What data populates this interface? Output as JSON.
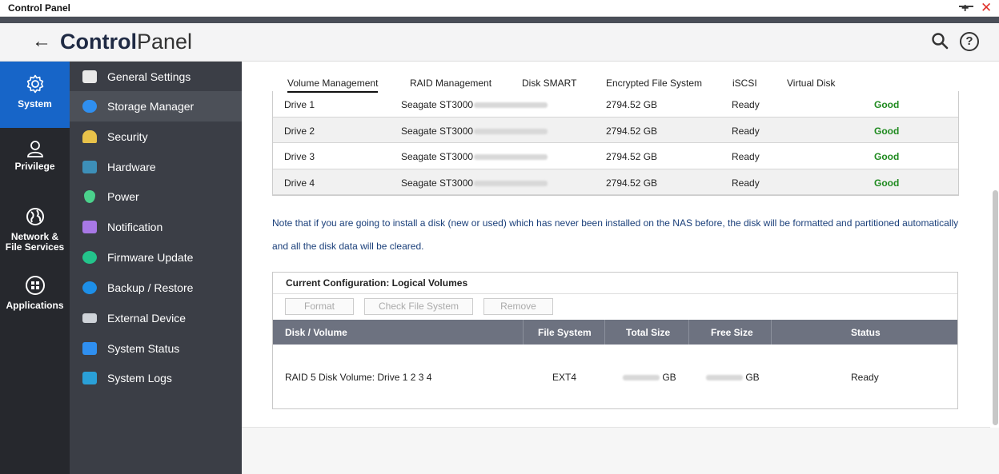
{
  "window": {
    "title": "Control Panel",
    "controls": {
      "minimize": "—",
      "maximize": "+",
      "close": "✕"
    }
  },
  "header": {
    "title_bold": "Control",
    "title_thin": "Panel",
    "back_icon": "←",
    "help_icon": "?"
  },
  "rail": {
    "items": [
      {
        "label": "System",
        "icon": "gear-icon"
      },
      {
        "label": "Privilege",
        "icon": "user-icon"
      },
      {
        "label_line1": "Network &",
        "label_line2": "File Services",
        "icon": "globe-icon"
      },
      {
        "label": "Applications",
        "icon": "apps-grid-icon"
      }
    ]
  },
  "submenu": {
    "items": [
      {
        "label": "General Settings",
        "icon_color": "#e8e8e8"
      },
      {
        "label": "Storage Manager",
        "icon_color": "#2f8ff0"
      },
      {
        "label": "Security",
        "icon_color": "#e8c24a"
      },
      {
        "label": "Hardware",
        "icon_color": "#3d8fb8"
      },
      {
        "label": "Power",
        "icon_color": "#4bd18c"
      },
      {
        "label": "Notification",
        "icon_color": "#a878e6"
      },
      {
        "label": "Firmware Update",
        "icon_color": "#23c48b"
      },
      {
        "label": "Backup / Restore",
        "icon_color": "#1d8fe8"
      },
      {
        "label": "External Device",
        "icon_color": "#cfd3d9"
      },
      {
        "label": "System Status",
        "icon_color": "#2f8ff0"
      },
      {
        "label": "System Logs",
        "icon_color": "#2aa0d8"
      }
    ]
  },
  "tabs": [
    "Volume Management",
    "RAID Management",
    "Disk SMART",
    "Encrypted File System",
    "iSCSI",
    "Virtual Disk"
  ],
  "drives": [
    {
      "name": "Drive 1",
      "model": "Seagate ST3000",
      "size": "2794.52 GB",
      "status": "Ready",
      "health": "Good"
    },
    {
      "name": "Drive 2",
      "model": "Seagate ST3000",
      "size": "2794.52 GB",
      "status": "Ready",
      "health": "Good"
    },
    {
      "name": "Drive 3",
      "model": "Seagate ST3000",
      "size": "2794.52 GB",
      "status": "Ready",
      "health": "Good"
    },
    {
      "name": "Drive 4",
      "model": "Seagate ST3000",
      "size": "2794.52 GB",
      "status": "Ready",
      "health": "Good"
    }
  ],
  "note": "Note that if you are going to install a disk (new or used) which has never been installed on the NAS before, the disk will be formatted and partitioned automatically and all the disk data will be cleared.",
  "logical": {
    "heading": "Current Configuration: Logical Volumes",
    "buttons": {
      "format": "Format",
      "check": "Check File System",
      "remove": "Remove"
    },
    "columns": {
      "disk": "Disk / Volume",
      "fs": "File System",
      "total": "Total Size",
      "free": "Free Size",
      "status": "Status"
    },
    "row": {
      "disk": "RAID 5 Disk Volume: Drive 1 2 3 4",
      "fs": "EXT4",
      "total_unit": "GB",
      "free_unit": "GB",
      "status": "Ready"
    }
  },
  "colors": {
    "accent": "#1765c8",
    "good": "#1f8a1f",
    "note_text": "#1a3f7a",
    "table_header": "#6d7280"
  }
}
